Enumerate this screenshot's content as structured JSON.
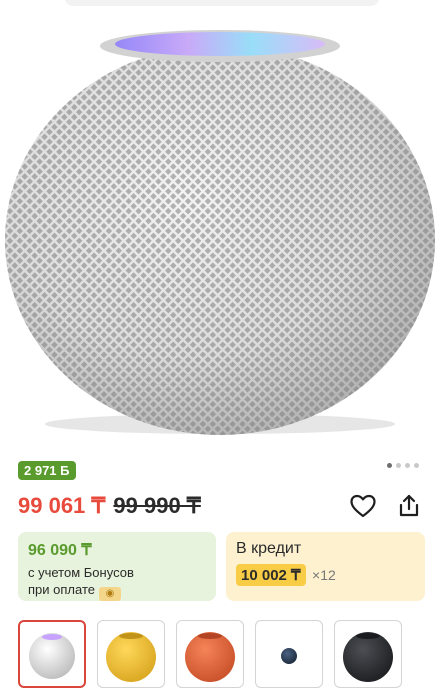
{
  "product": {
    "bonus_badge": "2 971 Б",
    "price_current": "99 061 ₸",
    "price_old": "99 990 ₸",
    "gallery_dots": 4,
    "gallery_active_index": 0
  },
  "bonus_card": {
    "amount": "96 090 ₸",
    "line1": "с учетом Бонусов",
    "line2": "при оплате"
  },
  "credit_card": {
    "title": "В кредит",
    "amount": "10 002 ₸",
    "multiplier": "×12"
  },
  "actions": {
    "favorite_icon": "heart-icon",
    "share_icon": "share-icon"
  },
  "variants": [
    {
      "color": "white",
      "hex": "#e9e9e9",
      "selected": true
    },
    {
      "color": "yellow",
      "hex": "#f3c43b",
      "selected": false
    },
    {
      "color": "orange",
      "hex": "#e8663a",
      "selected": false
    },
    {
      "color": "blue",
      "hex": "#2c3e56",
      "selected": false
    },
    {
      "color": "space-gray",
      "hex": "#2f3236",
      "selected": false
    }
  ]
}
